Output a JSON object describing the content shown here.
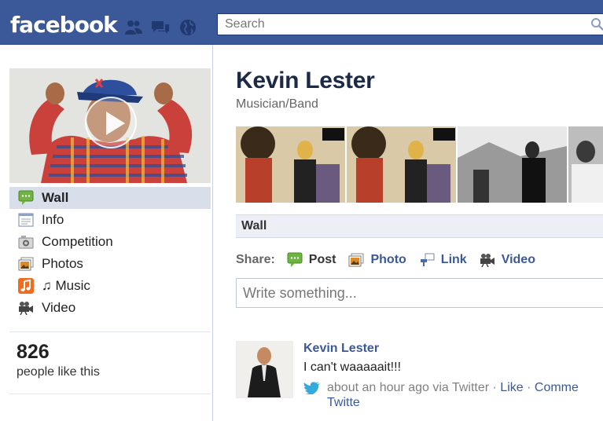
{
  "topbar": {
    "logo": "facebook",
    "search_placeholder": "Search"
  },
  "profile": {
    "name": "Kevin Lester",
    "category": "Musician/Band",
    "likes_count": "826",
    "likes_label": "people like this"
  },
  "sidebar": {
    "items": [
      {
        "label": "Wall",
        "icon": "wall-icon",
        "active": true
      },
      {
        "label": "Info",
        "icon": "info-icon"
      },
      {
        "label": "Competition",
        "icon": "competition-icon"
      },
      {
        "label": "Photos",
        "icon": "photos-icon"
      },
      {
        "label": "♫ Music",
        "icon": "music-icon"
      },
      {
        "label": "Video",
        "icon": "video-icon"
      }
    ]
  },
  "wall": {
    "tab_label": "Wall",
    "share_label": "Share:",
    "share_options": [
      {
        "label": "Post",
        "icon": "post-icon",
        "active": true
      },
      {
        "label": "Photo",
        "icon": "photo-icon"
      },
      {
        "label": "Link",
        "icon": "link-icon"
      },
      {
        "label": "Video",
        "icon": "video-camera-icon"
      }
    ],
    "composer_placeholder": "Write something..."
  },
  "stories": [
    {
      "author": "Kevin Lester",
      "text": "I can't waaaaait!!!",
      "time": "about an hour ago via Twitter",
      "sep": "·",
      "like": "Like",
      "comment": "Comme",
      "retweet": "Twitte"
    }
  ],
  "colors": {
    "brand": "#3b5998",
    "nav_active": "#d8dfea",
    "wall_bar": "#eceff5"
  }
}
